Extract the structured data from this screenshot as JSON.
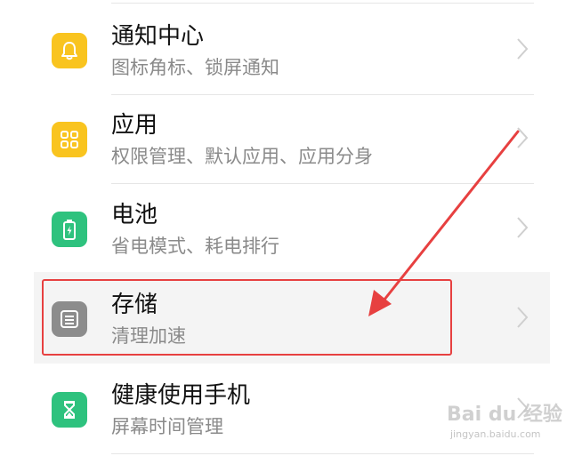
{
  "settings_list": {
    "items": [
      {
        "title": "通知中心",
        "subtitle": "图标角标、锁屏通知",
        "icon": "bell-icon",
        "icon_color": "#f9c41f"
      },
      {
        "title": "应用",
        "subtitle": "权限管理、默认应用、应用分身",
        "icon": "apps-grid-icon",
        "icon_color": "#f9c41f"
      },
      {
        "title": "电池",
        "subtitle": "省电模式、耗电排行",
        "icon": "battery-icon",
        "icon_color": "#2ec27e"
      },
      {
        "title": "存储",
        "subtitle": "清理加速",
        "icon": "storage-icon",
        "icon_color": "#8c8c8c"
      },
      {
        "title": "健康使用手机",
        "subtitle": "屏幕时间管理",
        "icon": "hourglass-icon",
        "icon_color": "#2ec27e"
      }
    ]
  },
  "annotation": {
    "highlight_color": "#e74040",
    "highlighted_item": "存储"
  },
  "watermark": {
    "logo": "Bai du 经验",
    "url": "jingyan.baidu.com"
  }
}
